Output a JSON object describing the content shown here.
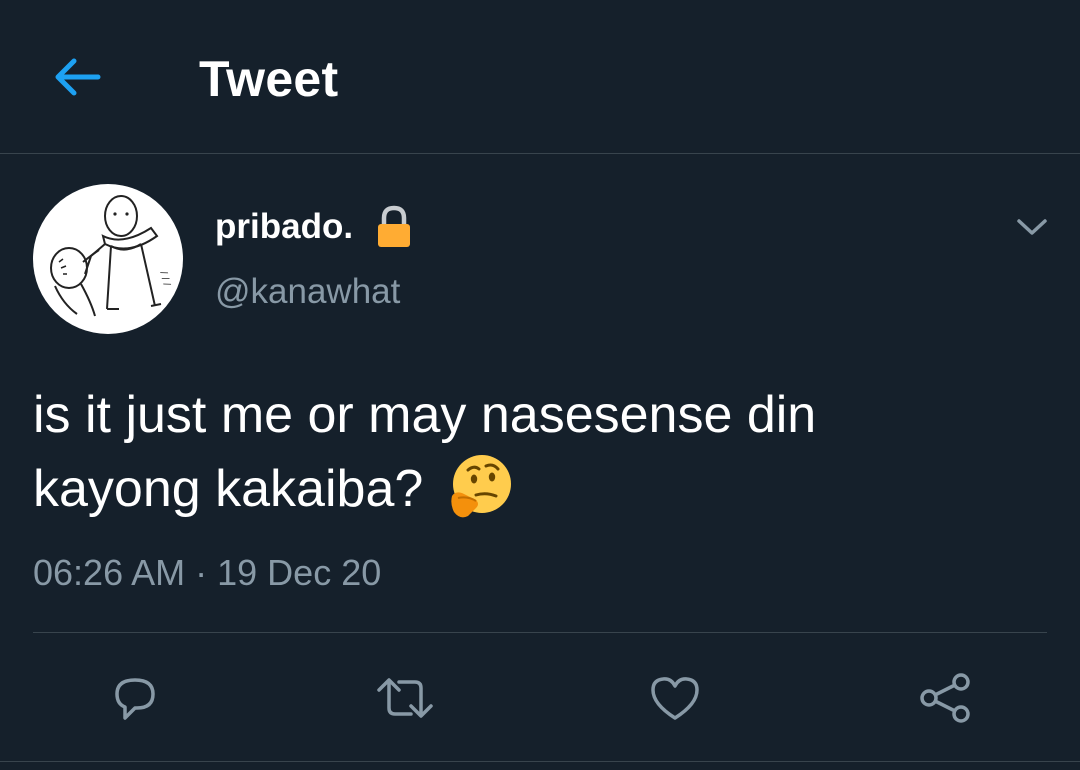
{
  "header": {
    "title": "Tweet",
    "back_icon": "arrow-left-icon"
  },
  "tweet": {
    "author": {
      "display_name": "pribado.",
      "handle": "@kanawhat",
      "protected_icon": "lock-icon"
    },
    "text_line1": "is it just me or may nasesense din",
    "text_line2": "kayong kakaiba?",
    "emoji": "thinking-face",
    "time": "06:26 AM",
    "separator": "·",
    "date": "19 Dec 20"
  },
  "actions": [
    "reply-icon",
    "retweet-icon",
    "like-icon",
    "share-icon"
  ],
  "colors": {
    "background": "#15202b",
    "accent": "#1da1f2",
    "secondary_text": "#8899a6",
    "divider": "#38444d"
  }
}
